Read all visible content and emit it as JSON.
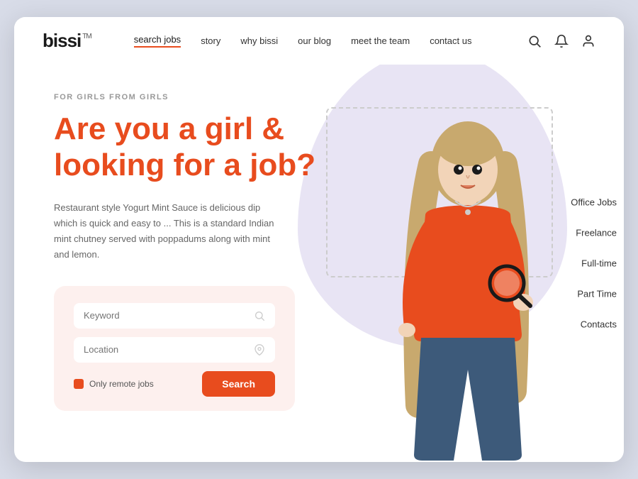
{
  "logo": {
    "text": "bissi",
    "tm": "TM"
  },
  "nav": {
    "links": [
      {
        "label": "search jobs",
        "active": true
      },
      {
        "label": "story",
        "active": false
      },
      {
        "label": "why bissi",
        "active": false
      },
      {
        "label": "our blog",
        "active": false
      },
      {
        "label": "meet the team",
        "active": false
      },
      {
        "label": "contact us",
        "active": false
      }
    ]
  },
  "hero": {
    "tagline": "FOR GIRLS FROM GIRLS",
    "title": "Are you a girl & looking for a job?",
    "description": "Restaurant style Yogurt Mint Sauce is delicious dip which is quick and easy to ... This is a standard Indian mint chutney served with poppadums along with mint and lemon.",
    "search": {
      "keyword_placeholder": "Keyword",
      "location_placeholder": "Location",
      "remote_label": "Only remote jobs",
      "button_label": "Search"
    }
  },
  "side_links": [
    {
      "label": "Office Jobs"
    },
    {
      "label": "Freelance"
    },
    {
      "label": "Full-time"
    },
    {
      "label": "Part Time"
    },
    {
      "label": "Contacts"
    }
  ],
  "colors": {
    "accent": "#e84c1e",
    "blob": "#e8e4f4"
  }
}
